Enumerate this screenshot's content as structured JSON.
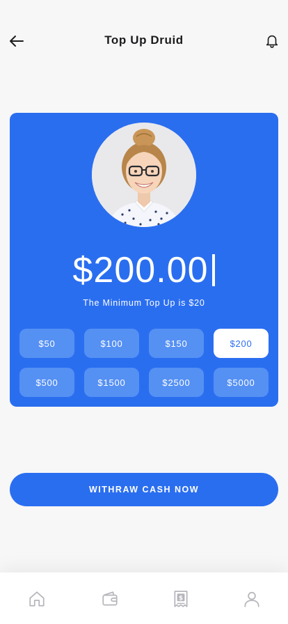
{
  "header": {
    "title": "Top Up Druid",
    "back_icon": "arrow-left-icon",
    "notification_icon": "bell-icon"
  },
  "card": {
    "background_color": "#2a6ef0",
    "avatar_alt": "profile-photo",
    "amount": "$200.00",
    "minimum_note": "The Minimum Top Up is $20",
    "options": [
      {
        "label": "$50",
        "selected": false
      },
      {
        "label": "$100",
        "selected": false
      },
      {
        "label": "$150",
        "selected": false
      },
      {
        "label": "$200",
        "selected": true
      },
      {
        "label": "$500",
        "selected": false
      },
      {
        "label": "$1500",
        "selected": false
      },
      {
        "label": "$2500",
        "selected": false
      },
      {
        "label": "$5000",
        "selected": false
      }
    ]
  },
  "cta": {
    "label": "WITHRAW CASH NOW"
  },
  "tabbar": {
    "items": [
      {
        "icon": "home-icon"
      },
      {
        "icon": "wallet-icon"
      },
      {
        "icon": "receipt-icon"
      },
      {
        "icon": "profile-icon"
      }
    ]
  },
  "colors": {
    "primary": "#2a6ef0",
    "chip": "#5590f3",
    "background": "#f7f7f8",
    "icon_gray": "#b5b5bb"
  }
}
